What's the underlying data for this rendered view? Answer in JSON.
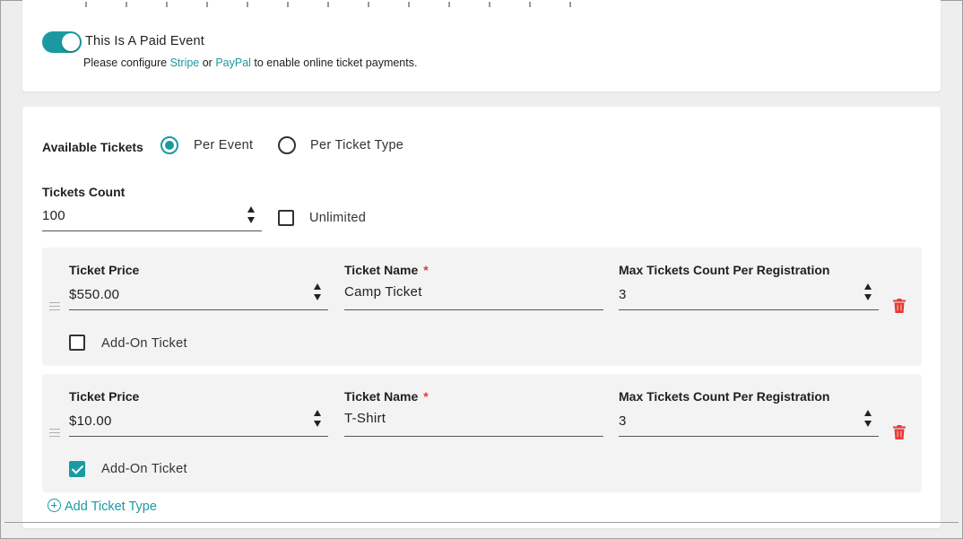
{
  "paid_event": {
    "toggle_label": "This Is A Paid Event",
    "toggle_on": true,
    "hint_prefix": "Please configure ",
    "stripe_link": "Stripe",
    "hint_or": " or ",
    "paypal_link": "PayPal",
    "hint_suffix": " to enable online ticket payments."
  },
  "tickets": {
    "available_label": "Available Tickets",
    "option_per_event": "Per Event",
    "option_per_ticket_type": "Per Ticket Type",
    "selected_option": "Per Event",
    "count_label": "Tickets Count",
    "count_value": "100",
    "unlimited_label": "Unlimited",
    "unlimited_checked": false,
    "items": [
      {
        "price_label": "Ticket Price",
        "price_value": "$550.00",
        "name_label": "Ticket Name",
        "name_required": "*",
        "name_value": "Camp Ticket",
        "max_label": "Max Tickets Count Per Registration",
        "max_value": "3",
        "addon_label": "Add-On Ticket",
        "addon_checked": false
      },
      {
        "price_label": "Ticket Price",
        "price_value": "$10.00",
        "name_label": "Ticket Name",
        "name_required": "*",
        "name_value": "T-Shirt",
        "max_label": "Max Tickets Count Per Registration",
        "max_value": "3",
        "addon_label": "Add-On Ticket",
        "addon_checked": true
      }
    ],
    "add_ticket_type": "Add Ticket Type"
  },
  "colors": {
    "accent": "#1a9aa0",
    "danger": "#e53935",
    "card_bg": "#ffffff",
    "ticket_bg": "#f3f3f3",
    "page_bg": "#eeeeee"
  },
  "icons": {
    "drag": "drag-handle-icon",
    "delete": "trash-icon",
    "add": "plus-circle-icon",
    "spinner": "spinner-arrows-icon"
  }
}
